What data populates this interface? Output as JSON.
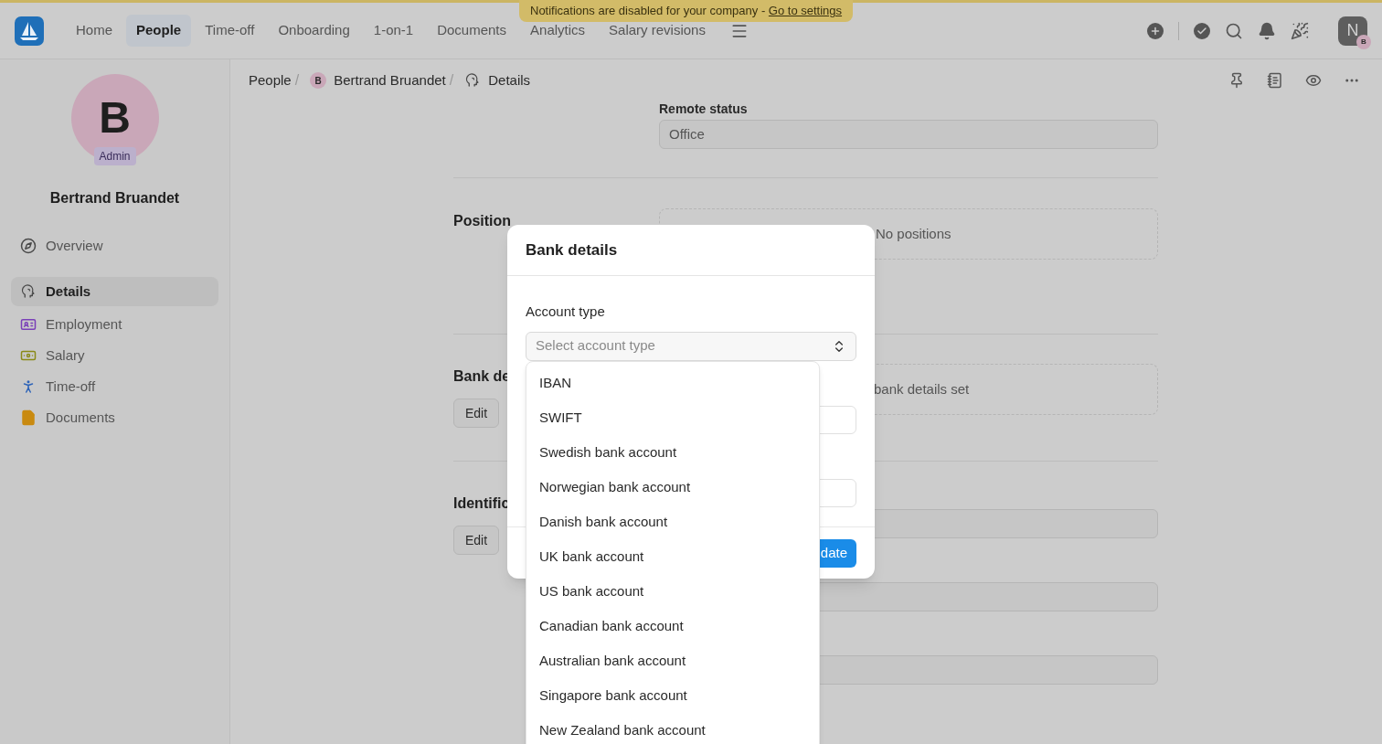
{
  "banner": {
    "text": "Notifications are disabled for your company - ",
    "link": "Go to settings"
  },
  "nav": {
    "items": [
      {
        "label": "Home",
        "selected": false
      },
      {
        "label": "People",
        "selected": true
      },
      {
        "label": "Time-off",
        "selected": false
      },
      {
        "label": "Onboarding",
        "selected": false
      },
      {
        "label": "1-on-1",
        "selected": false
      },
      {
        "label": "Documents",
        "selected": false
      },
      {
        "label": "Analytics",
        "selected": false
      },
      {
        "label": "Salary revisions",
        "selected": false
      }
    ],
    "avatar": "N",
    "avatar_badge": "B"
  },
  "sidebar": {
    "avatar": "B",
    "role": "Admin",
    "name": "Bertrand Bruandet",
    "items": [
      {
        "label": "Overview",
        "selected": false
      },
      {
        "label": "Details",
        "selected": true
      },
      {
        "label": "Employment",
        "selected": false
      },
      {
        "label": "Salary",
        "selected": false
      },
      {
        "label": "Time-off",
        "selected": false
      },
      {
        "label": "Documents",
        "selected": false
      }
    ]
  },
  "breadcrumb_separator": "/",
  "breadcrumb": [
    {
      "label": "People",
      "kind": "text"
    },
    {
      "label": "Bertrand Bruandet",
      "kind": "person",
      "avatar": "B"
    },
    {
      "label": "Details",
      "kind": "page"
    }
  ],
  "content": {
    "remote_label": "Remote status",
    "remote_value": "Office",
    "position_heading": "Position",
    "position_empty": "No positions",
    "bank_heading": "Bank de",
    "bank_edit": "Edit",
    "bank_empty": "bank details set",
    "ident_heading": "Identific",
    "ident_edit": "Edit"
  },
  "modal": {
    "title": "Bank details",
    "field_label": "Account type",
    "placeholder": "Select account type",
    "button": "date",
    "options": [
      {
        "label": "IBAN"
      },
      {
        "label": "SWIFT"
      },
      {
        "label": "Swedish bank account"
      },
      {
        "label": "Norwegian bank account"
      },
      {
        "label": "Danish bank account"
      },
      {
        "label": "UK bank account"
      },
      {
        "label": "US bank account"
      },
      {
        "label": "Canadian bank account"
      },
      {
        "label": "Australian bank account"
      },
      {
        "label": "Singapore bank account"
      },
      {
        "label": "New Zealand bank account"
      }
    ]
  }
}
